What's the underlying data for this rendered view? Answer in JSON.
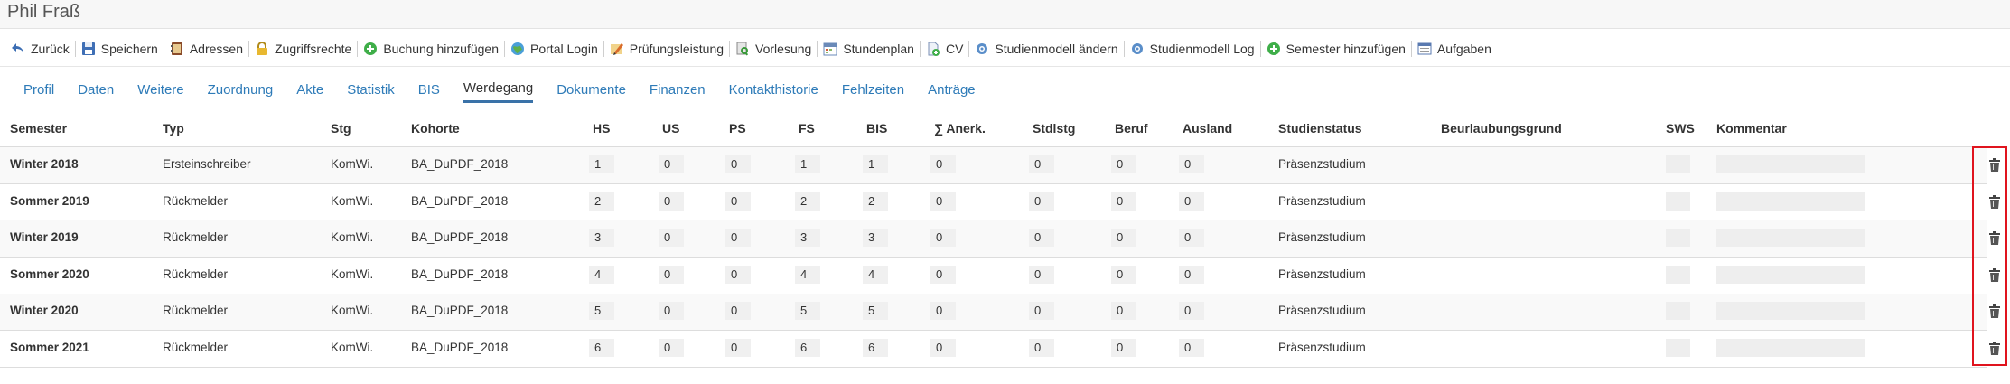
{
  "page": {
    "title": "Phil Fraß"
  },
  "toolbar": [
    {
      "label": "Zurück",
      "icon": "back-arrow-icon"
    },
    {
      "label": "Speichern",
      "icon": "floppy-disk-icon"
    },
    {
      "label": "Adressen",
      "icon": "address-book-icon"
    },
    {
      "label": "Zugriffsrechte",
      "icon": "padlock-icon"
    },
    {
      "label": "Buchung hinzufügen",
      "icon": "green-plus-icon"
    },
    {
      "label": "Portal Login",
      "icon": "globe-icon"
    },
    {
      "label": "Prüfungsleistung",
      "icon": "pencil-icon"
    },
    {
      "label": "Vorlesung",
      "icon": "document-search-icon"
    },
    {
      "label": "Stundenplan",
      "icon": "calendar-icon"
    },
    {
      "label": "CV",
      "icon": "document-add-icon"
    },
    {
      "label": "Studienmodell ändern",
      "icon": "cog-icon"
    },
    {
      "label": "Studienmodell Log",
      "icon": "cog-icon"
    },
    {
      "label": "Semester hinzufügen",
      "icon": "green-plus-icon"
    },
    {
      "label": "Aufgaben",
      "icon": "task-list-icon"
    }
  ],
  "tabs": [
    {
      "label": "Profil"
    },
    {
      "label": "Daten"
    },
    {
      "label": "Weitere"
    },
    {
      "label": "Zuordnung"
    },
    {
      "label": "Akte"
    },
    {
      "label": "Statistik"
    },
    {
      "label": "BIS"
    },
    {
      "label": "Werdegang",
      "active": true
    },
    {
      "label": "Dokumente"
    },
    {
      "label": "Finanzen"
    },
    {
      "label": "Kontakthistorie"
    },
    {
      "label": "Fehlzeiten"
    },
    {
      "label": "Anträge"
    }
  ],
  "table": {
    "headers": {
      "semester": "Semester",
      "typ": "Typ",
      "stg": "Stg",
      "kohorte": "Kohorte",
      "hs": "HS",
      "us": "US",
      "ps": "PS",
      "fs": "FS",
      "bis": "BIS",
      "anerk": "∑ Anerk.",
      "stdlstg": "Stdlstg",
      "beruf": "Beruf",
      "ausland": "Ausland",
      "studienstatus": "Studienstatus",
      "beurlaubungsgrund": "Beurlaubungsgrund",
      "sws": "SWS",
      "kommentar": "Kommentar"
    },
    "rows": [
      {
        "semester": "Winter 2018",
        "typ": "Ersteinschreiber",
        "stg": "KomWi.",
        "kohorte": "BA_DuPDF_2018",
        "hs": "1",
        "us": "0",
        "ps": "0",
        "fs": "1",
        "bis": "1",
        "anerk": "0",
        "stdlstg": "0",
        "beruf": "0",
        "ausland": "0",
        "studienstatus": "Präsenzstudium"
      },
      {
        "semester": "Sommer 2019",
        "typ": "Rückmelder",
        "stg": "KomWi.",
        "kohorte": "BA_DuPDF_2018",
        "hs": "2",
        "us": "0",
        "ps": "0",
        "fs": "2",
        "bis": "2",
        "anerk": "0",
        "stdlstg": "0",
        "beruf": "0",
        "ausland": "0",
        "studienstatus": "Präsenzstudium"
      },
      {
        "semester": "Winter 2019",
        "typ": "Rückmelder",
        "stg": "KomWi.",
        "kohorte": "BA_DuPDF_2018",
        "hs": "3",
        "us": "0",
        "ps": "0",
        "fs": "3",
        "bis": "3",
        "anerk": "0",
        "stdlstg": "0",
        "beruf": "0",
        "ausland": "0",
        "studienstatus": "Präsenzstudium"
      },
      {
        "semester": "Sommer 2020",
        "typ": "Rückmelder",
        "stg": "KomWi.",
        "kohorte": "BA_DuPDF_2018",
        "hs": "4",
        "us": "0",
        "ps": "0",
        "fs": "4",
        "bis": "4",
        "anerk": "0",
        "stdlstg": "0",
        "beruf": "0",
        "ausland": "0",
        "studienstatus": "Präsenzstudium"
      },
      {
        "semester": "Winter 2020",
        "typ": "Rückmelder",
        "stg": "KomWi.",
        "kohorte": "BA_DuPDF_2018",
        "hs": "5",
        "us": "0",
        "ps": "0",
        "fs": "5",
        "bis": "5",
        "anerk": "0",
        "stdlstg": "0",
        "beruf": "0",
        "ausland": "0",
        "studienstatus": "Präsenzstudium"
      },
      {
        "semester": "Sommer 2021",
        "typ": "Rückmelder",
        "stg": "KomWi.",
        "kohorte": "BA_DuPDF_2018",
        "hs": "6",
        "us": "0",
        "ps": "0",
        "fs": "6",
        "bis": "6",
        "anerk": "0",
        "stdlstg": "0",
        "beruf": "0",
        "ausland": "0",
        "studienstatus": "Präsenzstudium"
      }
    ],
    "row_action_icon": "trash-icon"
  },
  "colors": {
    "link": "#2e7bb8",
    "active_tab_underline": "#3a72a8",
    "highlight": "#e0141e"
  }
}
